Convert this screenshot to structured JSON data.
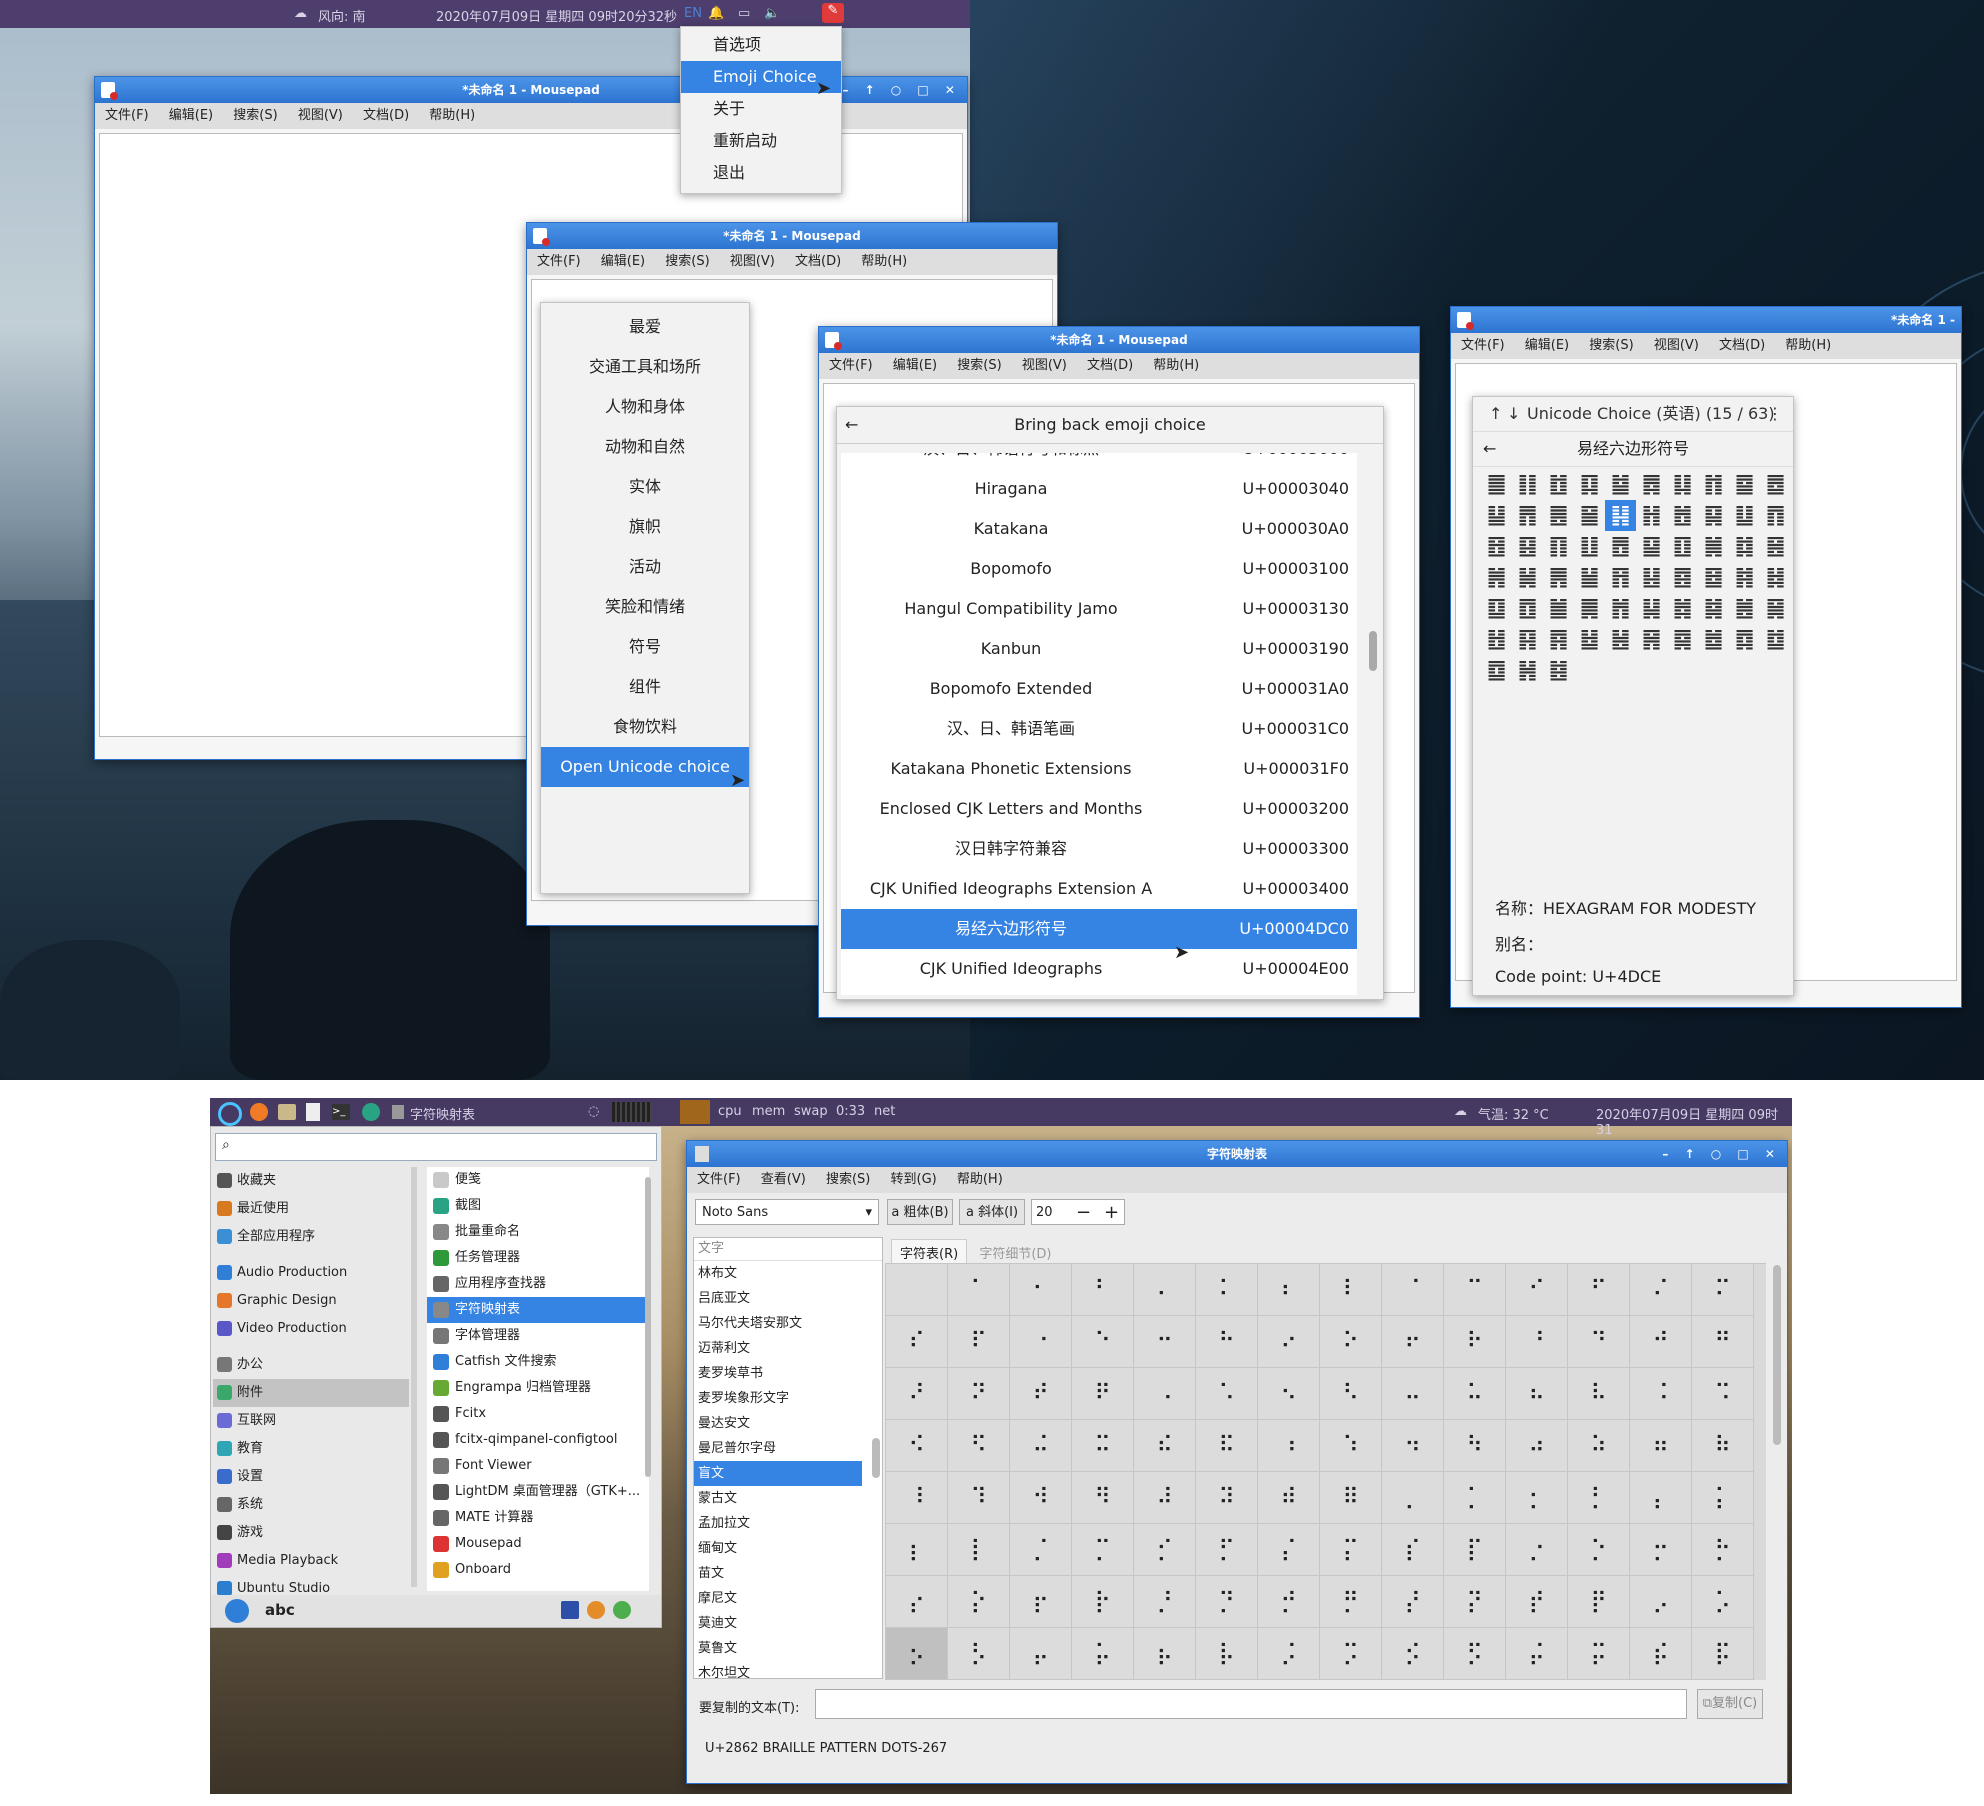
{
  "top_panel": {
    "weather": "风向: 南",
    "datetime": "2020年07月09日 星期四 09时20分32秒",
    "lang": "EN"
  },
  "popup_menu": {
    "items": [
      "首选项",
      "Emoji Choice",
      "关于",
      "重新启动",
      "退出"
    ],
    "selected": "Emoji Choice"
  },
  "mousepad": {
    "title": "*未命名 1 - Mousepad",
    "title_short": "*未命名 1 -",
    "controls": "– ↑ ○ □ ✕",
    "menus": [
      "文件(F)",
      "编辑(E)",
      "搜索(S)",
      "视图(V)",
      "文档(D)",
      "帮助(H)"
    ]
  },
  "emoji_categories": {
    "items": [
      "最爱",
      "交通工具和场所",
      "人物和身体",
      "动物和自然",
      "实体",
      "旗帜",
      "活动",
      "笑脸和情绪",
      "符号",
      "组件",
      "食物饮料",
      "Open Unicode choice"
    ],
    "selected": "Open Unicode choice"
  },
  "unicode_blocks": {
    "header": "Bring back emoji choice",
    "back_icon": "arrow-left-icon",
    "rows": [
      {
        "name": "汉、日、韩语符号和标点",
        "code": "U+00003000"
      },
      {
        "name": "Hiragana",
        "code": "U+00003040"
      },
      {
        "name": "Katakana",
        "code": "U+000030A0"
      },
      {
        "name": "Bopomofo",
        "code": "U+00003100"
      },
      {
        "name": "Hangul Compatibility Jamo",
        "code": "U+00003130"
      },
      {
        "name": "Kanbun",
        "code": "U+00003190"
      },
      {
        "name": "Bopomofo Extended",
        "code": "U+000031A0"
      },
      {
        "name": "汉、日、韩语笔画",
        "code": "U+000031C0"
      },
      {
        "name": "Katakana Phonetic Extensions",
        "code": "U+000031F0"
      },
      {
        "name": "Enclosed CJK Letters and Months",
        "code": "U+00003200"
      },
      {
        "name": "汉日韩字符兼容",
        "code": "U+00003300"
      },
      {
        "name": "CJK Unified Ideographs Extension A",
        "code": "U+00003400"
      },
      {
        "name": "易经六边形符号",
        "code": "U+00004DC0"
      },
      {
        "name": "CJK Unified Ideographs",
        "code": "U+00004E00"
      }
    ],
    "selected_index": 12
  },
  "unicode_choice": {
    "header": "Unicode Choice (英语) (15 / 63)",
    "block": "易经六边形符号",
    "glyphs": [
      "䷀",
      "䷁",
      "䷂",
      "䷃",
      "䷄",
      "䷅",
      "䷆",
      "䷇",
      "䷈",
      "䷉",
      "䷊",
      "䷋",
      "䷌",
      "䷍",
      "䷎",
      "䷏",
      "䷐",
      "䷑",
      "䷒",
      "䷓",
      "䷔",
      "䷕",
      "䷖",
      "䷗",
      "䷘",
      "䷙",
      "䷚",
      "䷛",
      "䷜",
      "䷝",
      "䷞",
      "䷟",
      "䷠",
      "䷡",
      "䷢",
      "䷣",
      "䷤",
      "䷥",
      "䷦",
      "䷧",
      "䷨",
      "䷩",
      "䷪",
      "䷫",
      "䷬",
      "䷭",
      "䷮",
      "䷯",
      "䷰",
      "䷱",
      "䷲",
      "䷳",
      "䷴",
      "䷵",
      "䷶",
      "䷷",
      "䷸",
      "䷹",
      "䷺",
      "䷻",
      "䷼",
      "䷽",
      "䷾"
    ],
    "selected_index": 14,
    "name_line": "名称：HEXAGRAM FOR MODESTY",
    "alias_line": "别名：",
    "code_line": "Code point: U+4DCE"
  },
  "bottom_panel": {
    "task": "字符映射表",
    "monitors": [
      "cpu",
      "mem",
      "swap",
      "0:33",
      "net"
    ],
    "weather": "气温: 32 °C",
    "datetime": "2020年07月09日 星期四 09时31"
  },
  "app_menu": {
    "categories": [
      {
        "label": "收藏夹",
        "color": "#555555"
      },
      {
        "label": "最近使用",
        "color": "#d77a1f"
      },
      {
        "label": "全部应用程序",
        "color": "#3b8fd4"
      },
      {
        "label": "Audio Production",
        "color": "#2f7fd8"
      },
      {
        "label": "Graphic Design",
        "color": "#e5762a"
      },
      {
        "label": "Video Production",
        "color": "#5a58c8"
      },
      {
        "label": "办公",
        "color": "#777777"
      },
      {
        "label": "附件",
        "color": "#3aa86a"
      },
      {
        "label": "互联网",
        "color": "#6b6bd6"
      },
      {
        "label": "教育",
        "color": "#2ea6b5"
      },
      {
        "label": "设置",
        "color": "#3a6ccd"
      },
      {
        "label": "系统",
        "color": "#666666"
      },
      {
        "label": "游戏",
        "color": "#444444"
      },
      {
        "label": "Media Playback",
        "color": "#a13dbb"
      },
      {
        "label": "Ubuntu Studio Information",
        "color": "#2c7fd0"
      }
    ],
    "selected_category": "附件",
    "apps": [
      {
        "label": "便笺",
        "color": "#c9c9c9"
      },
      {
        "label": "截图",
        "color": "#2aa384"
      },
      {
        "label": "批量重命名",
        "color": "#888888"
      },
      {
        "label": "任务管理器",
        "color": "#2f9a3a"
      },
      {
        "label": "应用程序查找器",
        "color": "#666666"
      },
      {
        "label": "字符映射表",
        "color": "#888888"
      },
      {
        "label": "字体管理器",
        "color": "#777777"
      },
      {
        "label": "Catfish 文件搜索",
        "color": "#2f7fd8"
      },
      {
        "label": "Engrampa 归档管理器",
        "color": "#66aa33"
      },
      {
        "label": "Fcitx",
        "color": "#555555"
      },
      {
        "label": "fcitx-qimpanel-configtool",
        "color": "#555555"
      },
      {
        "label": "Font Viewer",
        "color": "#777777"
      },
      {
        "label": "LightDM 桌面管理器（GTK+...",
        "color": "#555555"
      },
      {
        "label": "MATE 计算器",
        "color": "#666666"
      },
      {
        "label": "Mousepad",
        "color": "#d33"
      },
      {
        "label": "Onboard",
        "color": "#e0a020"
      }
    ],
    "selected_app": "字符映射表",
    "user": "abc"
  },
  "charmap": {
    "title": "字符映射表",
    "controls": "– ↑ ○ □ ✕",
    "menus": [
      "文件(F)",
      "查看(V)",
      "搜索(S)",
      "转到(G)",
      "帮助(H)"
    ],
    "font": "Noto Sans",
    "bold_label": "粗体(B)",
    "italic_label": "斜体(I)",
    "size": "20",
    "list_header": "文字",
    "scripts": [
      "林布文",
      "吕底亚文",
      "马尔代夫塔安那文",
      "迈蒂利文",
      "麦罗埃草书",
      "麦罗埃象形文字",
      "曼达安文",
      "曼尼普尔字母",
      "盲文",
      "蒙古文",
      "孟加拉文",
      "缅甸文",
      "苗文",
      "摩尼文",
      "莫迪文",
      "莫鲁文",
      "木尔坦文"
    ],
    "selected_script": "盲文",
    "tab_table": "字符表(R)",
    "tab_detail": "字符细节(D)",
    "glyphs": [
      "",
      "⠁",
      "⠂",
      "⠃",
      "⠄",
      "⠅",
      "⠆",
      "⠇",
      "⠈",
      "⠉",
      "⠊",
      "⠋",
      "⠌",
      "⠍",
      "⠎",
      "⠏",
      "⠐",
      "⠑",
      "⠒",
      "⠓",
      "⠔",
      "⠕",
      "⠖",
      "⠗",
      "⠘",
      "⠙",
      "⠚",
      "⠛",
      "⠜",
      "⠝",
      "⠞",
      "⠟",
      "⠠",
      "⠡",
      "⠢",
      "⠣",
      "⠤",
      "⠥",
      "⠦",
      "⠧",
      "⠨",
      "⠩",
      "⠪",
      "⠫",
      "⠬",
      "⠭",
      "⠮",
      "⠯",
      "⠰",
      "⠱",
      "⠲",
      "⠳",
      "⠴",
      "⠵",
      "⠶",
      "⠷",
      "⠸",
      "⠹",
      "⠺",
      "⠻",
      "⠼",
      "⠽",
      "⠾",
      "⠿",
      "⡀",
      "⡁",
      "⡂",
      "⡃",
      "⡄",
      "⡅",
      "⡆",
      "⡇",
      "⡈",
      "⡉",
      "⡊",
      "⡋",
      "⡌",
      "⡍",
      "⡎",
      "⡏",
      "⡐",
      "⡑",
      "⡒",
      "⡓",
      "⡔",
      "⡕",
      "⡖",
      "⡗",
      "⡘",
      "⡙",
      "⡚",
      "⡛",
      "⡜",
      "⡝",
      "⡞",
      "⡟",
      "⡠",
      "⡡",
      "⡢",
      "⡣",
      "⡤",
      "⡥",
      "⡦",
      "⡧",
      "⡨",
      "⡩",
      "⡪",
      "⡫",
      "⡬",
      "⡭",
      "⡮",
      "⡯",
      "⡰",
      "⡱",
      "⡲",
      "⡳",
      "⡴",
      "⡵",
      "⡶",
      "⡷"
    ],
    "selected_glyph_index": 98,
    "copy_label": "要复制的文本(T):",
    "copy_button": "复制(C)",
    "status": "U+2862 BRAILLE PATTERN DOTS-267"
  }
}
